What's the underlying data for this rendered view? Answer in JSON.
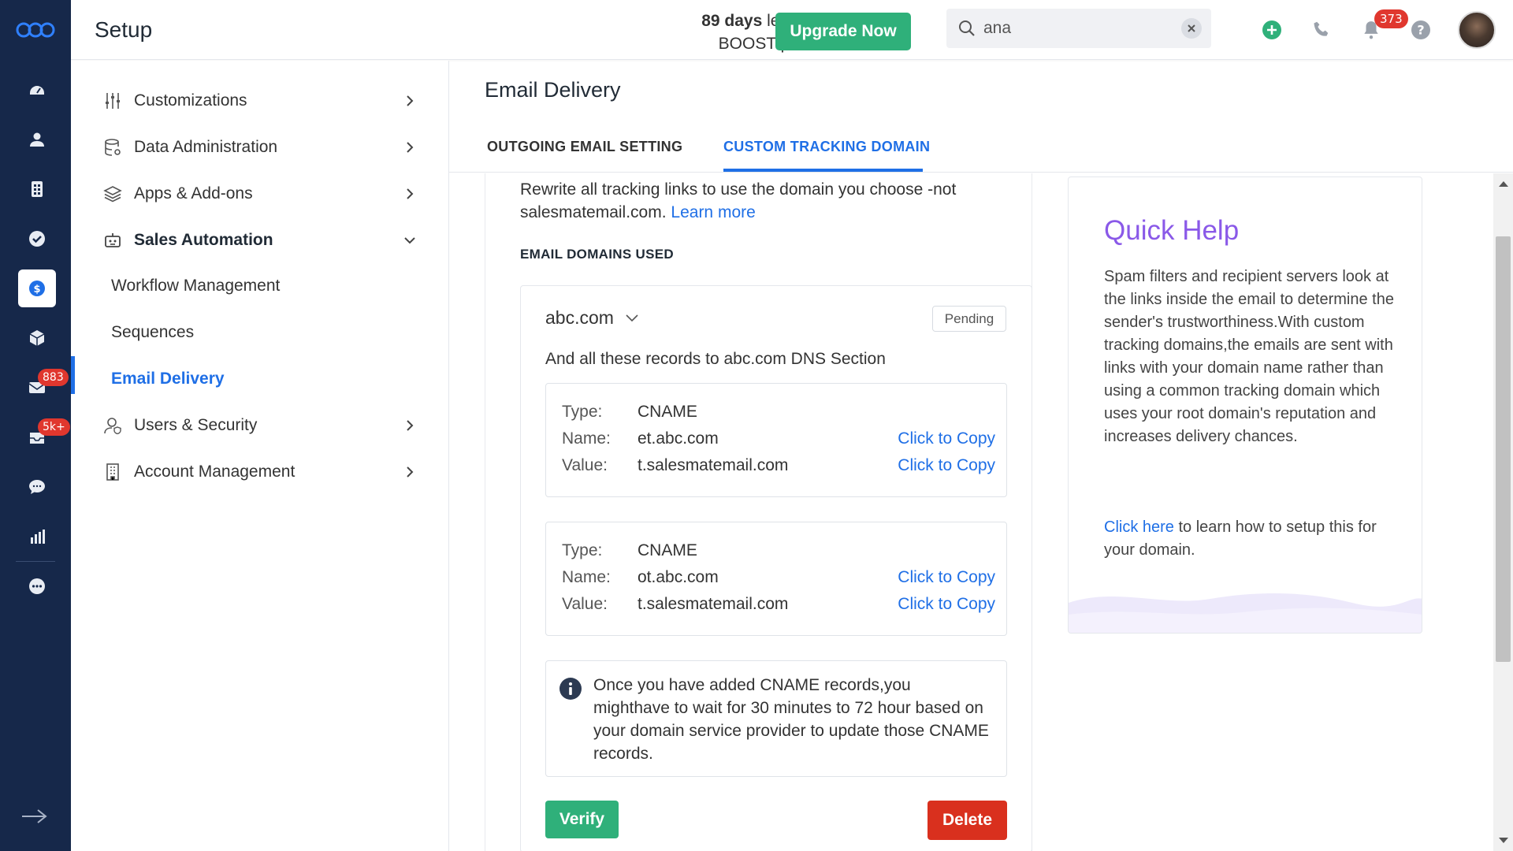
{
  "topbar": {
    "title": "Setup",
    "trial_days": "89 days",
    "trial_rest_line1": " left in your",
    "trial_line2": "BOOST plan trial",
    "upgrade_label": "Upgrade Now",
    "search_value": "ana",
    "notification_count": "373"
  },
  "rail": {
    "mail_badge": "883",
    "inbox_badge": "5k+"
  },
  "sidebar": {
    "items": [
      {
        "label": "Customizations"
      },
      {
        "label": "Data Administration"
      },
      {
        "label": "Apps & Add-ons"
      },
      {
        "label": "Sales Automation"
      },
      {
        "label": "Users & Security"
      },
      {
        "label": "Account Management"
      }
    ],
    "sub_items": [
      {
        "label": "Workflow Management"
      },
      {
        "label": "Sequences"
      },
      {
        "label": "Email Delivery"
      }
    ]
  },
  "main": {
    "title": "Email Delivery",
    "tabs": [
      {
        "label": "OUTGOING EMAIL SETTING"
      },
      {
        "label": "CUSTOM TRACKING DOMAIN"
      }
    ],
    "intro_text": "Rewrite all tracking links to use the domain you choose -not salesmatemail.com.",
    "learn_more": "Learn more",
    "section_label": "EMAIL DOMAINS USED",
    "domain": "abc.com",
    "status": "Pending",
    "dns_note": "And all these records to abc.com DNS Section",
    "records": [
      {
        "type_label": "Type:",
        "type": "CNAME",
        "name_label": "Name:",
        "name": "et.abc.com",
        "value_label": "Value:",
        "value": "t.salesmatemail.com",
        "copy_label": "Click to Copy"
      },
      {
        "type_label": "Type:",
        "type": "CNAME",
        "name_label": "Name:",
        "name": "ot.abc.com",
        "value_label": "Value:",
        "value": "t.salesmatemail.com",
        "copy_label": "Click to Copy"
      }
    ],
    "info_text": "Once you have added CNAME records,you mighthave to wait for 30 minutes to 72 hour based on your domain service provider to update those CNAME records.",
    "verify_label": "Verify",
    "delete_label": "Delete"
  },
  "help": {
    "title": "Quick Help",
    "body": "Spam filters and recipient servers look at the links inside the email to determine the sender's trustworthiness.With custom tracking domains,the emails are sent with links with your domain name rather than using a common tracking domain which uses your root domain's reputation and increases delivery chances.",
    "link_label": "Click here",
    "link_suffix": " to learn how to setup this for your domain."
  },
  "colors": {
    "rail": "#16284a",
    "accent_blue": "#1f6fe6",
    "success_green": "#2fb07a",
    "danger_red": "#d9301e",
    "help_purple": "#8a59e8"
  }
}
